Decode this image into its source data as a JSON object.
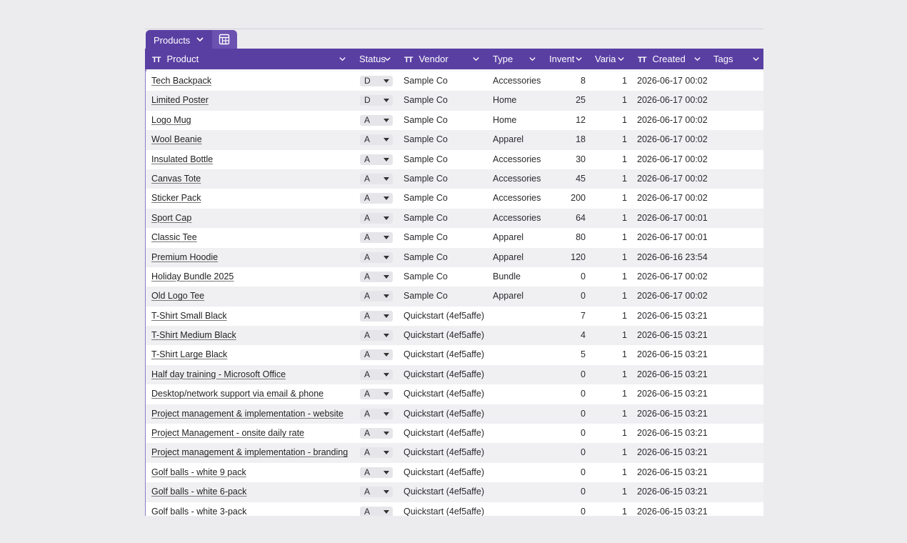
{
  "tab": {
    "label": "Products"
  },
  "columns": {
    "product": "Product",
    "status": "Status",
    "vendor": "Vendor",
    "type": "Type",
    "inventory": "Invent",
    "variants": "Varia",
    "created": "Created",
    "tags": "Tags",
    "text_type_icon": "TT"
  },
  "rows": [
    {
      "product": "Tech Backpack",
      "status": "D",
      "vendor": "Sample Co",
      "type": "Accessories",
      "inventory": "8",
      "variants": "1",
      "created": "2026-06-17 00:02"
    },
    {
      "product": "Limited Poster",
      "status": "D",
      "vendor": "Sample Co",
      "type": "Home",
      "inventory": "25",
      "variants": "1",
      "created": "2026-06-17 00:02"
    },
    {
      "product": "Logo Mug",
      "status": "A",
      "vendor": "Sample Co",
      "type": "Home",
      "inventory": "12",
      "variants": "1",
      "created": "2026-06-17 00:02"
    },
    {
      "product": "Wool Beanie",
      "status": "A",
      "vendor": "Sample Co",
      "type": "Apparel",
      "inventory": "18",
      "variants": "1",
      "created": "2026-06-17 00:02"
    },
    {
      "product": "Insulated Bottle",
      "status": "A",
      "vendor": "Sample Co",
      "type": "Accessories",
      "inventory": "30",
      "variants": "1",
      "created": "2026-06-17 00:02"
    },
    {
      "product": "Canvas Tote",
      "status": "A",
      "vendor": "Sample Co",
      "type": "Accessories",
      "inventory": "45",
      "variants": "1",
      "created": "2026-06-17 00:02"
    },
    {
      "product": "Sticker Pack",
      "status": "A",
      "vendor": "Sample Co",
      "type": "Accessories",
      "inventory": "200",
      "variants": "1",
      "created": "2026-06-17 00:02"
    },
    {
      "product": "Sport Cap",
      "status": "A",
      "vendor": "Sample Co",
      "type": "Accessories",
      "inventory": "64",
      "variants": "1",
      "created": "2026-06-17 00:01"
    },
    {
      "product": "Classic Tee",
      "status": "A",
      "vendor": "Sample Co",
      "type": "Apparel",
      "inventory": "80",
      "variants": "1",
      "created": "2026-06-17 00:01"
    },
    {
      "product": "Premium Hoodie",
      "status": "A",
      "vendor": "Sample Co",
      "type": "Apparel",
      "inventory": "120",
      "variants": "1",
      "created": "2026-06-16 23:54"
    },
    {
      "product": "Holiday Bundle 2025",
      "status": "A",
      "vendor": "Sample Co",
      "type": "Bundle",
      "inventory": "0",
      "variants": "1",
      "created": "2026-06-17 00:02"
    },
    {
      "product": "Old Logo Tee",
      "status": "A",
      "vendor": "Sample Co",
      "type": "Apparel",
      "inventory": "0",
      "variants": "1",
      "created": "2026-06-17 00:02"
    },
    {
      "product": "T-Shirt Small Black",
      "status": "A",
      "vendor": "Quickstart (4ef5affe)",
      "type": "",
      "inventory": "7",
      "variants": "1",
      "created": "2026-06-15 03:21"
    },
    {
      "product": "T-Shirt Medium Black",
      "status": "A",
      "vendor": "Quickstart (4ef5affe)",
      "type": "",
      "inventory": "4",
      "variants": "1",
      "created": "2026-06-15 03:21"
    },
    {
      "product": "T-Shirt Large Black",
      "status": "A",
      "vendor": "Quickstart (4ef5affe)",
      "type": "",
      "inventory": "5",
      "variants": "1",
      "created": "2026-06-15 03:21"
    },
    {
      "product": "Half day training - Microsoft Office",
      "status": "A",
      "vendor": "Quickstart (4ef5affe)",
      "type": "",
      "inventory": "0",
      "variants": "1",
      "created": "2026-06-15 03:21"
    },
    {
      "product": "Desktop/network support via email & phone",
      "status": "A",
      "vendor": "Quickstart (4ef5affe)",
      "type": "",
      "inventory": "0",
      "variants": "1",
      "created": "2026-06-15 03:21"
    },
    {
      "product": "Project management & implementation - website",
      "status": "A",
      "vendor": "Quickstart (4ef5affe)",
      "type": "",
      "inventory": "0",
      "variants": "1",
      "created": "2026-06-15 03:21"
    },
    {
      "product": "Project Management - onsite daily rate",
      "status": "A",
      "vendor": "Quickstart (4ef5affe)",
      "type": "",
      "inventory": "0",
      "variants": "1",
      "created": "2026-06-15 03:21"
    },
    {
      "product": "Project management & implementation - branding",
      "status": "A",
      "vendor": "Quickstart (4ef5affe)",
      "type": "",
      "inventory": "0",
      "variants": "1",
      "created": "2026-06-15 03:21"
    },
    {
      "product": "Golf balls - white 9 pack",
      "status": "A",
      "vendor": "Quickstart (4ef5affe)",
      "type": "",
      "inventory": "0",
      "variants": "1",
      "created": "2026-06-15 03:21"
    },
    {
      "product": "Golf balls - white 6-pack",
      "status": "A",
      "vendor": "Quickstart (4ef5affe)",
      "type": "",
      "inventory": "0",
      "variants": "1",
      "created": "2026-06-15 03:21"
    },
    {
      "product": "Golf balls - white 3-pack",
      "status": "A",
      "vendor": "Quickstart (4ef5affe)",
      "type": "",
      "inventory": "0",
      "variants": "1",
      "created": "2026-06-15 03:21"
    }
  ]
}
